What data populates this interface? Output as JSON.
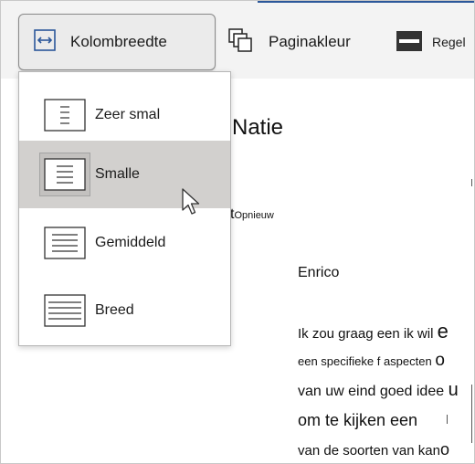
{
  "ribbon": {
    "column_width_label": "Kolombreedte",
    "page_color_label": "Paginakleur",
    "line_label": "Regel"
  },
  "menu": {
    "items": [
      {
        "label": "Zeer smal",
        "selected": false
      },
      {
        "label": "Smalle",
        "selected": true
      },
      {
        "label": "Gemiddeld",
        "selected": false
      },
      {
        "label": "Breed",
        "selected": false
      }
    ]
  },
  "document": {
    "title_fragment": "Natie",
    "opnieuw_prefix": "t",
    "opnieuw_small": "Opnieuw",
    "salutation": "Enrico",
    "lines": [
      {
        "text": "Ik zou graag een ik wil ",
        "tail": "e"
      },
      {
        "text": "een specifieke f aspecten ",
        "tail": "o"
      },
      {
        "text": "van uw eind goed idee ",
        "tail": "u"
      },
      {
        "text": "om te kijken een",
        "tail": ""
      },
      {
        "text": "van de soorten van kan",
        "tail": "o"
      }
    ]
  },
  "colors": {
    "accent": "#2b579a",
    "selection": "#d2d0ce",
    "ribbon_bg": "#f3f3f3"
  }
}
